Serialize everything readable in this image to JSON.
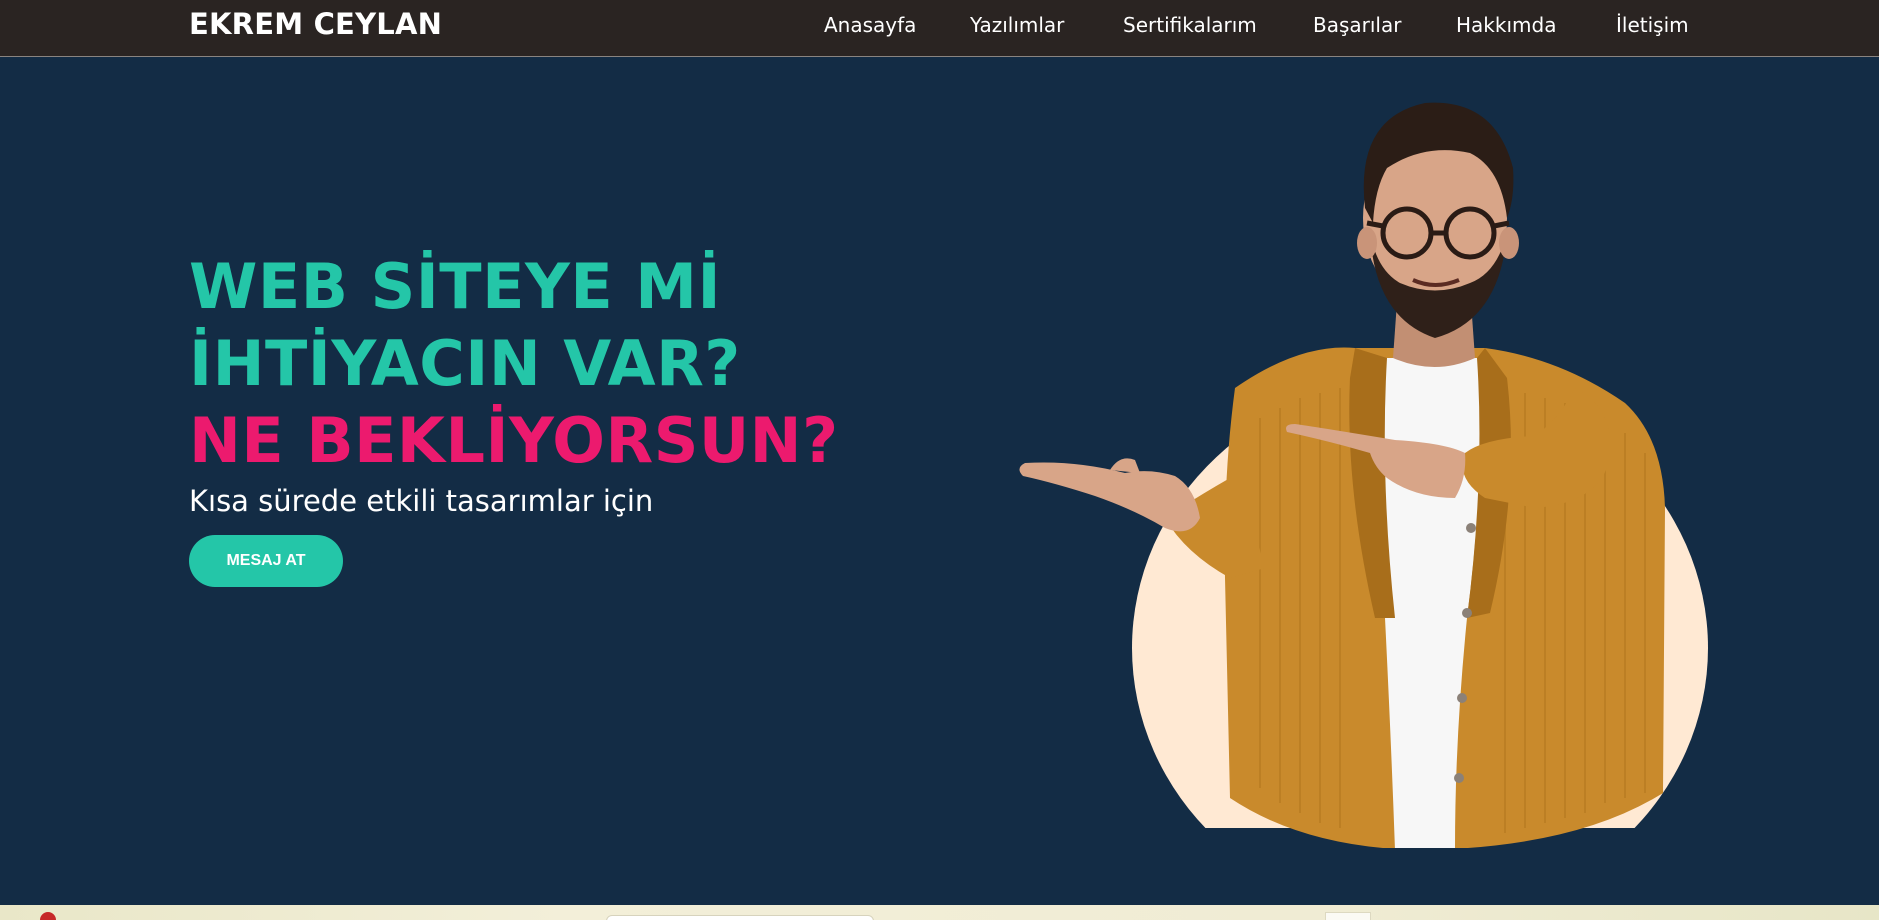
{
  "brand": {
    "name": "EKREM CEYLAN"
  },
  "nav": {
    "items": [
      {
        "label": "Anasayfa"
      },
      {
        "label": "Yazılımlar"
      },
      {
        "label": "Sertifikalarım"
      },
      {
        "label": "Başarılar"
      },
      {
        "label": "Hakkımda"
      },
      {
        "label": "İletişim"
      }
    ]
  },
  "hero": {
    "line1": "WEB SİTEYE Mİ",
    "line2": "İHTİYACIN VAR?",
    "line3": "NE BEKLİYORSUN?",
    "subtitle": "Kısa sürede etkili tasarımlar için",
    "cta_label": "MESAJ AT"
  },
  "colors": {
    "navbar_bg": "#2a2422",
    "hero_bg": "#132c45",
    "accent_teal": "#24c6a8",
    "accent_pink": "#ec1a6e",
    "circle_bg": "#ffe9d3"
  }
}
